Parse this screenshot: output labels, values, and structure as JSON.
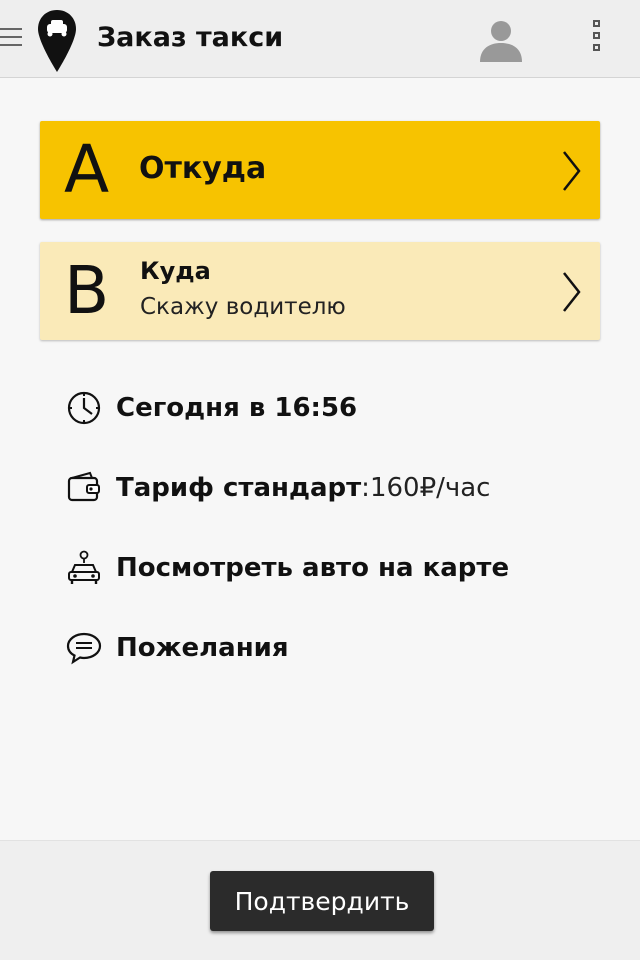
{
  "header": {
    "title": "Заказ такси",
    "menu_icon": "hamburger-icon",
    "logo_icon": "taxi-pin-icon",
    "profile_icon": "user-icon",
    "more_icon": "more-vertical-icon"
  },
  "route": {
    "from": {
      "letter": "A",
      "label": "Откуда"
    },
    "to": {
      "letter": "B",
      "label": "Куда",
      "sub": "Скажу водителю"
    }
  },
  "options": {
    "time": {
      "text": "Сегодня в 16:56",
      "icon": "clock-icon"
    },
    "tariff": {
      "text": "Тариф стандарт",
      "separator": ":",
      "value": " 160₽/час",
      "icon": "wallet-icon"
    },
    "map": {
      "text": "Посмотреть авто на карте",
      "icon": "car-location-icon"
    },
    "wishes": {
      "text": "Пожелания",
      "icon": "chat-bubble-icon"
    }
  },
  "footer": {
    "confirm_label": "Подтвердить"
  },
  "colors": {
    "accent": "#f7c300",
    "accent_light": "#faeab8",
    "button": "#2b2b2b"
  }
}
